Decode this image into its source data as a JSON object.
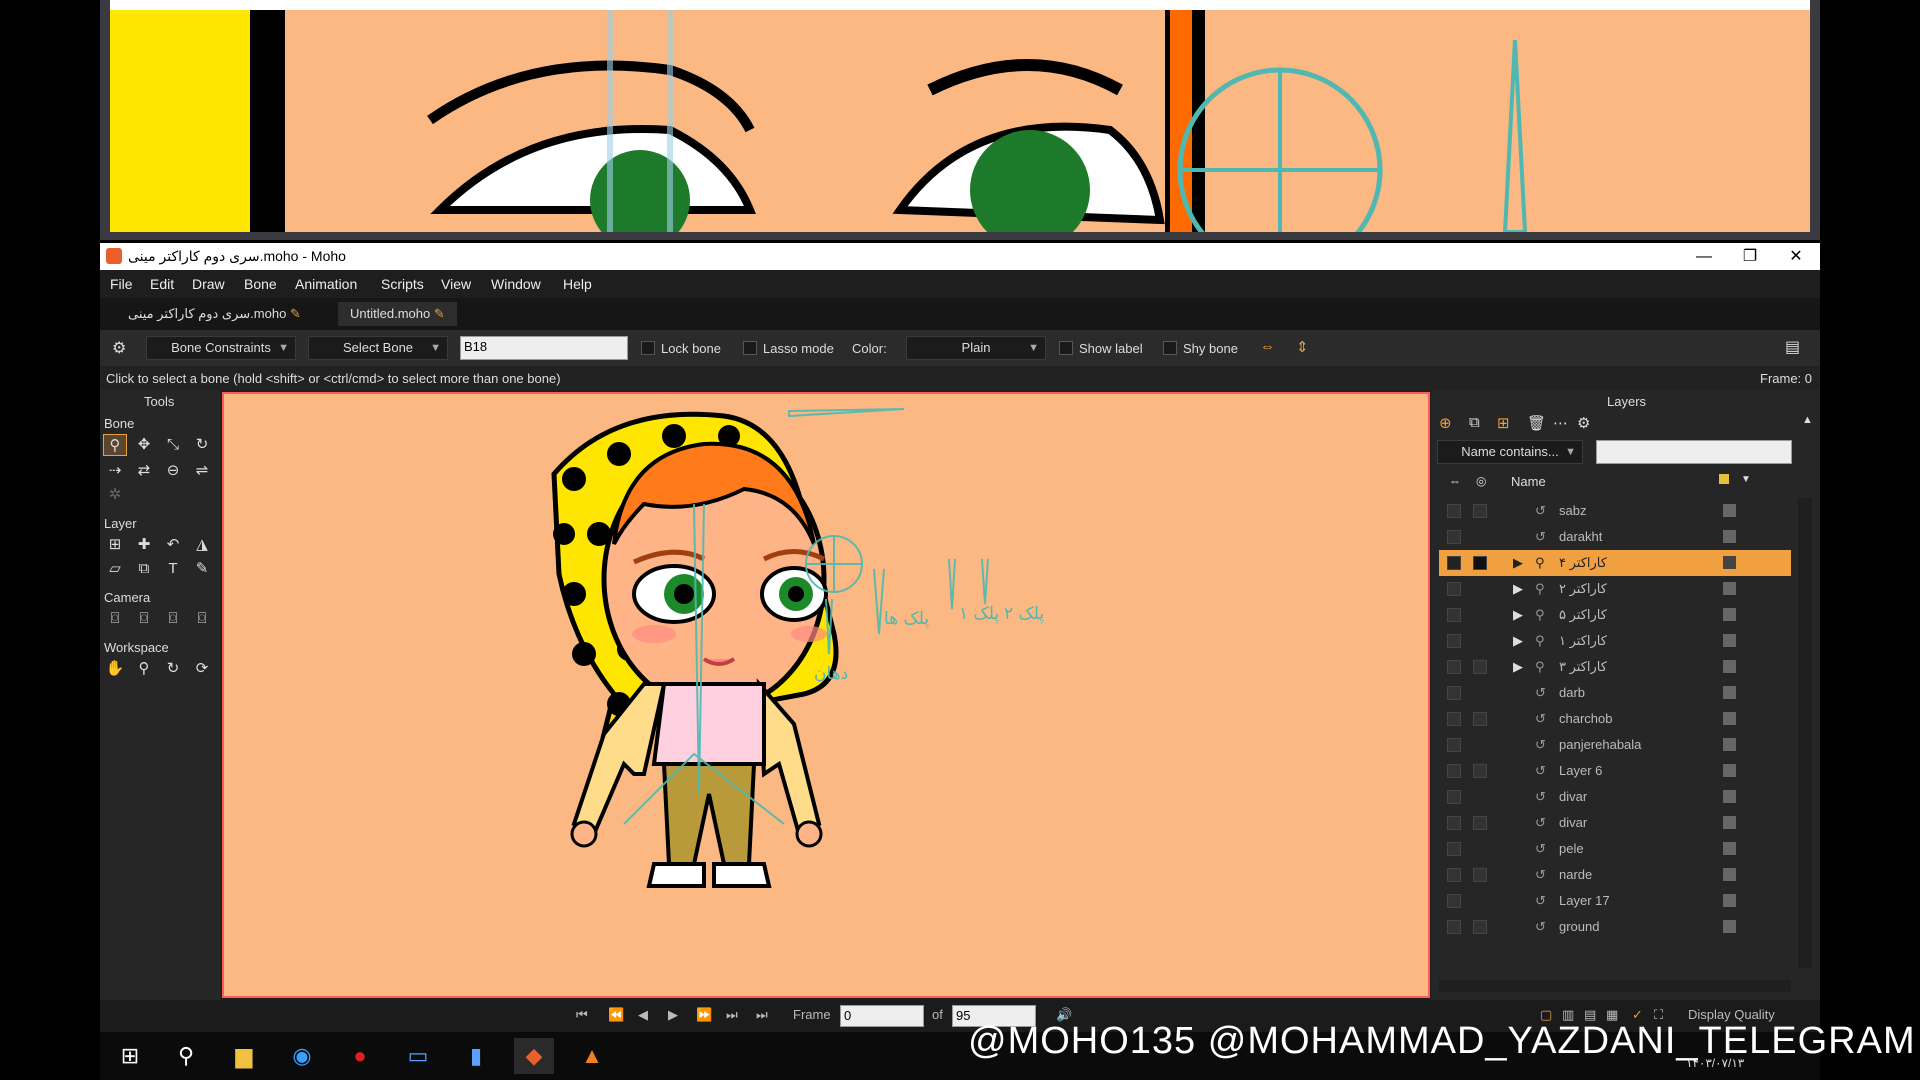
{
  "window": {
    "title": "سری دوم کاراکتر مینی.moho - Moho",
    "minimize": "—",
    "maximize": "❐",
    "close": "✕"
  },
  "menu": [
    "File",
    "Edit",
    "Draw",
    "Bone",
    "Animation",
    "Scripts",
    "View",
    "Window",
    "Help"
  ],
  "tabs": [
    {
      "label": "سری دوم کاراکتر مینی.moho"
    },
    {
      "label": "Untitled.moho"
    }
  ],
  "toolbar": {
    "constraints": "Bone Constraints",
    "select_bone": "Select Bone",
    "bone_name": "B18",
    "lock_bone": "Lock bone",
    "lasso_mode": "Lasso mode",
    "color_label": "Color:",
    "color_value": "Plain",
    "show_label": "Show label",
    "shy_bone": "Shy bone"
  },
  "status": {
    "hint": "Click to select a bone (hold <shift> or <ctrl/cmd> to select more than one bone)",
    "frame": "Frame: 0"
  },
  "tools": {
    "title": "Tools",
    "sections": {
      "bone": "Bone",
      "layer": "Layer",
      "camera": "Camera",
      "workspace": "Workspace"
    }
  },
  "canvas_labels": {
    "a": "پلک ها",
    "b": "پلک ۲",
    "c": "پلک ۱",
    "d": "دهان"
  },
  "layers": {
    "title": "Layers",
    "filter": "Name contains...",
    "column_name": "Name",
    "items": [
      {
        "name": "sabz"
      },
      {
        "name": "darakht"
      },
      {
        "name": "کاراکتر ۴"
      },
      {
        "name": "کاراکتر ۲"
      },
      {
        "name": "کاراکتر ۵"
      },
      {
        "name": "کاراکتر ۱"
      },
      {
        "name": "کاراکتر ۳"
      },
      {
        "name": "darb"
      },
      {
        "name": "charchob"
      },
      {
        "name": "panjerehabala"
      },
      {
        "name": "Layer 6"
      },
      {
        "name": "divar"
      },
      {
        "name": "divar"
      },
      {
        "name": "pele"
      },
      {
        "name": "narde"
      },
      {
        "name": "Layer 17"
      },
      {
        "name": "ground"
      }
    ]
  },
  "timeline": {
    "frame_label": "Frame",
    "frame_value": "0",
    "of_label": "of",
    "total": "95",
    "display_quality": "Display Quality"
  },
  "watermark": "@MOHO135 @MOHAMMAD_YAZDANI_TELEGRAM",
  "clock": "۱۴۰۳/۰۷/۱۳",
  "colors": {
    "accent": "#f0a040",
    "stage": "#fbb883",
    "stage_border": "#ff5b5b"
  }
}
